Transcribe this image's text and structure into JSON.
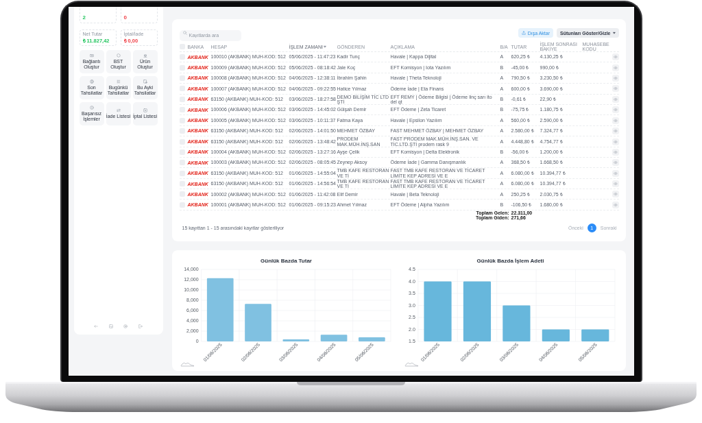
{
  "sidebar": {
    "stats": [
      {
        "value": "2",
        "kind": "positive"
      },
      {
        "value": "0",
        "kind": "negative"
      },
      {
        "label": "Net Tutar",
        "value": "₺ 11.827,42",
        "kind": "positive"
      },
      {
        "label": "İptal/İade",
        "value": "₺ 0,00",
        "kind": "negative"
      }
    ],
    "actions": [
      {
        "label": "Bağlantı Oluştur"
      },
      {
        "label": "BST Oluştur"
      },
      {
        "label": "Ürün Oluştur"
      },
      {
        "label": "Son Tahsilatlar"
      },
      {
        "label": "Bugünkü Tahsilatlar"
      },
      {
        "label": "Bu Ayki Tahsilatlar"
      },
      {
        "label": "Başarısız İşlemler"
      },
      {
        "label": "İade Listesi"
      },
      {
        "label": "İptal Listesi"
      }
    ]
  },
  "toolbar": {
    "search": {
      "placeholder": "Kayıtlarda ara"
    },
    "buttons": [
      {
        "label": "Dışa Aktar",
        "kind": "export"
      },
      {
        "label": "Sütunları Göster/Gizle",
        "kind": "dropdown"
      }
    ]
  },
  "table": {
    "select_all": {
      "checked": false
    },
    "columns": [
      {
        "label": "BANKA",
        "sorted": false
      },
      {
        "label": "HESAP",
        "sorted": false
      },
      {
        "label": "İŞLEM ZAMANI",
        "sorted": true
      },
      {
        "label": "GÖNDEREN",
        "sorted": false
      },
      {
        "label": "AÇIKLAMA",
        "sorted": false
      },
      {
        "label": "B/A",
        "sorted": false
      },
      {
        "label": "TUTAR",
        "sorted": false
      },
      {
        "label": "İŞLEM SONRASI BAKİYE",
        "sorted": false
      },
      {
        "label": "MUHASEBE KODU",
        "sorted": false
      }
    ],
    "rows": [
      {
        "checked": false,
        "bank": "AKBANK",
        "account": "100010 (AKBANK) MUH-KOD: 512",
        "time": "05/06/2025 - 11:47:23",
        "sender": "Kadir Tunç",
        "description": "Havale | Kappa Dijital",
        "direction": "A",
        "amount": "620,25 ₺",
        "balance": "4.130,25 ₺"
      },
      {
        "checked": false,
        "bank": "AKBANK",
        "account": "100009 (AKBANK) MUH-KOD: 512",
        "time": "05/06/2025 - 08:18:42",
        "sender": "Jale Koç",
        "description": "EFT Komisyon | Iota Yazılım",
        "direction": "B",
        "amount": "-45,00 ₺",
        "balance": "990,00 ₺"
      },
      {
        "checked": false,
        "bank": "AKBANK",
        "account": "100008 (AKBANK) MUH-KOD: 512",
        "time": "04/06/2025 - 12:38:11",
        "sender": "İbrahim Şahin",
        "description": "Havale | Theta Teknoloji",
        "direction": "A",
        "amount": "790,50 ₺",
        "balance": "3.230,50 ₺"
      },
      {
        "checked": false,
        "bank": "AKBANK",
        "account": "100007 (AKBANK) MUH-KOD: 512",
        "time": "04/06/2025 - 09:22:55",
        "sender": "Hatice Yılmaz",
        "description": "Ödeme İade | Eta Finans",
        "direction": "A",
        "amount": "600,00 ₺",
        "balance": "3.690,00 ₺"
      },
      {
        "checked": false,
        "bank": "AKBANK",
        "account": "63150 (AKBANK) MUH-KOD: 512",
        "time": "03/06/2025 - 18:27:58",
        "sender": "DEMO BİLİŞİM TİC LTD ŞTİ",
        "description": "EFT REMY | Ödeme Bilgisi | Ödeme linç sarı ito del qt",
        "direction": "B",
        "amount": "-0,61 ₺",
        "balance": "22,90 ₺"
      },
      {
        "checked": false,
        "bank": "AKBANK",
        "account": "100006 (AKBANK) MUH-KOD: 512",
        "time": "03/06/2025 - 14:45:02",
        "sender": "Gülşah Demir",
        "description": "EFT Ödeme | Zeta Ticaret",
        "direction": "B",
        "amount": "-75,75 ₺",
        "balance": "1.180,75 ₺"
      },
      {
        "checked": false,
        "bank": "AKBANK",
        "account": "100005 (AKBANK) MUH-KOD: 512",
        "time": "03/06/2025 - 10:11:37",
        "sender": "Fatma Kaya",
        "description": "Havale | Epsilon Yazılım",
        "direction": "A",
        "amount": "560,00 ₺",
        "balance": "2.590,00 ₺"
      },
      {
        "checked": false,
        "bank": "AKBANK",
        "account": "63150 (AKBANK) MUH-KOD: 512",
        "time": "02/06/2025 - 14:01:50",
        "sender": "MEHMET ÖZBAY",
        "description": "FAST MEHMET ÖZBAY | MEHMET ÖZBAY",
        "direction": "A",
        "amount": "2.580,00 ₺",
        "balance": "7.324,77 ₺"
      },
      {
        "checked": false,
        "bank": "AKBANK",
        "account": "63150 (AKBANK) MUH-KOD: 512",
        "time": "02/06/2025 - 13:48:42",
        "sender": "PRODEM MAK.MÜH.İNŞ.SAN",
        "description": "FAST PRODEM MAK.MÜH.İNŞ.SAN. VE TİC.LTD.ŞTİ prodem rask 9",
        "direction": "A",
        "amount": "4.448,80 ₺",
        "balance": "4.754,77 ₺"
      },
      {
        "checked": false,
        "bank": "AKBANK",
        "account": "100004 (AKBANK) MUH-KOD: 512",
        "time": "02/06/2025 - 13:27:16",
        "sender": "Ayşe Çelik",
        "description": "EFT Komisyon | Delta Elektronik",
        "direction": "B",
        "amount": "-56,00 ₺",
        "balance": "1.200,00 ₺"
      },
      {
        "checked": false,
        "bank": "AKBANK",
        "account": "100003 (AKBANK) MUH-KOD: 512",
        "time": "02/06/2025 - 08:05:45",
        "sender": "Zeynep Aksoy",
        "description": "Ödeme İade | Gamma Danışmanlık",
        "direction": "A",
        "amount": "368,50 ₺",
        "balance": "1.668,50 ₺"
      },
      {
        "checked": false,
        "bank": "AKBANK",
        "account": "63150 (AKBANK) MUH-KOD: 512",
        "time": "01/06/2025 - 14:55:04",
        "sender": "TMB KAFE RESTORAN VE Tİ",
        "description": "FAST TMB KAFE RESTORAN VE TİCARET LİMİTE KEP ADRESİ VE E",
        "direction": "A",
        "amount": "6.080,00 ₺",
        "balance": "10.394,77 ₺"
      },
      {
        "checked": false,
        "bank": "AKBANK",
        "account": "63150 (AKBANK) MUH-KOD: 512",
        "time": "01/06/2025 - 14:56:54",
        "sender": "TMB KAFE RESTORAN VE Tİ",
        "description": "FAST TMB KAFE RESTORAN VE TİCARET LİMİTE KEP ADRESİ VE E",
        "direction": "A",
        "amount": "6.080,00 ₺",
        "balance": "10.394,77 ₺"
      },
      {
        "checked": false,
        "bank": "AKBANK",
        "account": "100002 (AKBANK) MUH-KOD: 512",
        "time": "01/06/2025 - 11:42:08",
        "sender": "Elif Demir",
        "description": "Havale | Beta Teknoloji",
        "direction": "A",
        "amount": "250,25 ₺",
        "balance": "2.030,75 ₺"
      },
      {
        "checked": false,
        "bank": "AKBANK",
        "account": "100001 (AKBANK) MUH-KOD: 512",
        "time": "01/06/2025 - 09:15:23",
        "sender": "Ahmet Yılmaz",
        "description": "EFT Ödeme | Alpha Yazılım",
        "direction": "B",
        "amount": "-106,50 ₺",
        "balance": "1.680,00 ₺"
      }
    ],
    "totals": [
      {
        "label": "Toplam Gelen:",
        "value": "22.311,00"
      },
      {
        "label": "Toplam Giden:",
        "value": "271,66"
      }
    ]
  },
  "footer": {
    "summary": "15 kayıttan 1 - 15 arasındaki kayıtlar gösteriliyor",
    "previous": {
      "label": "Önceki",
      "disabled": true
    },
    "pages": [
      {
        "label": "1",
        "selected": true
      }
    ],
    "next": {
      "label": "Sonraki",
      "disabled": true
    }
  },
  "charts": [
    {
      "chart_data": {
        "type": "bar",
        "title": "Günlük Bazda Tutar",
        "grid": true,
        "categories": [
          "01/06/2025",
          "02/06/2025",
          "03/06/2025",
          "04/06/2025",
          "05/06/2025"
        ],
        "series": [
          {
            "color": "#80c1e1",
            "values": [
              12300,
              7300,
              400,
              1300,
              800
            ]
          }
        ],
        "ylim": [
          0,
          14000
        ],
        "yticks": [
          {
            "value": 0,
            "label": "0"
          },
          {
            "value": 2000,
            "label": "2,000"
          },
          {
            "value": 4000,
            "label": "4,000"
          },
          {
            "value": 6000,
            "label": "6,000"
          },
          {
            "value": 8000,
            "label": "8,000"
          },
          {
            "value": 10000,
            "label": "10,000"
          },
          {
            "value": 12000,
            "label": "12,000"
          },
          {
            "value": 14000,
            "label": "14,000"
          }
        ]
      }
    },
    {
      "chart_data": {
        "type": "bar",
        "title": "Günlük Bazda İşlem Adeti",
        "grid": true,
        "categories": [
          "01/06/2025",
          "02/06/2025",
          "03/06/2025",
          "04/06/2025",
          "05/06/2025"
        ],
        "series": [
          {
            "color": "#67b7dc",
            "values": [
              4,
              4,
              3,
              2,
              2
            ]
          }
        ],
        "ylim": [
          1.5,
          4.5
        ],
        "yticks": [
          {
            "value": 1.5,
            "label": "1.5"
          },
          {
            "value": 2,
            "label": "2.0"
          },
          {
            "value": 2.5,
            "label": "2.5"
          },
          {
            "value": 3,
            "label": "3.0"
          },
          {
            "value": 3.5,
            "label": "3.5"
          },
          {
            "value": 4,
            "label": "4.0"
          },
          {
            "value": 4.5,
            "label": "4.5"
          }
        ]
      }
    }
  ]
}
